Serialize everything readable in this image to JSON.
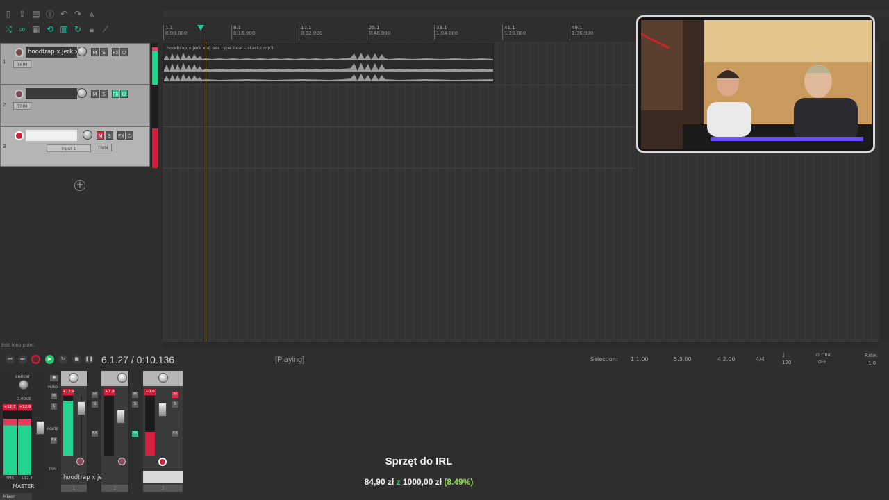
{
  "ruler": {
    "marks": [
      {
        "bar": "1.1",
        "time": "0:00.000"
      },
      {
        "bar": "9.1",
        "time": "0:16.000"
      },
      {
        "bar": "17.1",
        "time": "0:32.000"
      },
      {
        "bar": "25.1",
        "time": "0:48.000"
      },
      {
        "bar": "33.1",
        "time": "1:04.000"
      },
      {
        "bar": "41.1",
        "time": "1:20.000"
      },
      {
        "bar": "49.1",
        "time": "1:36.000"
      }
    ]
  },
  "tracks": [
    {
      "num": "1",
      "name": "hoodtrap x jerk x",
      "trim": "TRIM",
      "mute": "M",
      "solo": "S",
      "fx": "FX"
    },
    {
      "num": "2",
      "name": "",
      "trim": "TRIM",
      "mute": "M",
      "solo": "S",
      "fx": "FX"
    },
    {
      "num": "3",
      "name": "",
      "trim": "TRIM",
      "mute": "M",
      "solo": "S",
      "fx": "FX",
      "input": "Input 1",
      "peak": "+0.0"
    }
  ],
  "media_item": {
    "label": "hoodtrap x jerk x dj ess type beat - stackz.mp3"
  },
  "status": {
    "hint": "Edit loop point"
  },
  "transport": {
    "position": "6.1.27 / 0:10.136",
    "state": "[Playing]"
  },
  "selection": {
    "label": "Selection:",
    "start": "1.1.00",
    "end": "5.3.00",
    "length": "4.2.00",
    "time_sig": "4/4",
    "bpm": "120",
    "global": "GLOBAL",
    "global_state": "OFF",
    "rate_label": "Rate:",
    "rate": "1.0"
  },
  "mixer": {
    "master": {
      "pan": "center",
      "db": "0.00dB",
      "peak_l": "+12.7",
      "peak_r": "+12.9",
      "rms_label": "RMS",
      "rms_val": "+12.4",
      "label": "MASTER",
      "mono": "MONO",
      "route": "ROUTE",
      "trim": "TRIM"
    },
    "strips": [
      {
        "peak": "+12.9",
        "label": "hoodtrap x je",
        "num": "1"
      },
      {
        "peak": "+1.8",
        "label": "",
        "num": "2"
      },
      {
        "peak": "+0.0",
        "label": "",
        "num": "3"
      }
    ],
    "tab": "Mixer"
  },
  "overlay": {
    "title": "Sprzęt do IRL",
    "raised": "84,90 zł",
    "z": "z",
    "goal": "1000,00 zł",
    "percent": "(8.49%)"
  },
  "colors": {
    "accent_green": "#25c6a0",
    "record_red": "#d41f3c",
    "meter_green": "#23d48e"
  }
}
